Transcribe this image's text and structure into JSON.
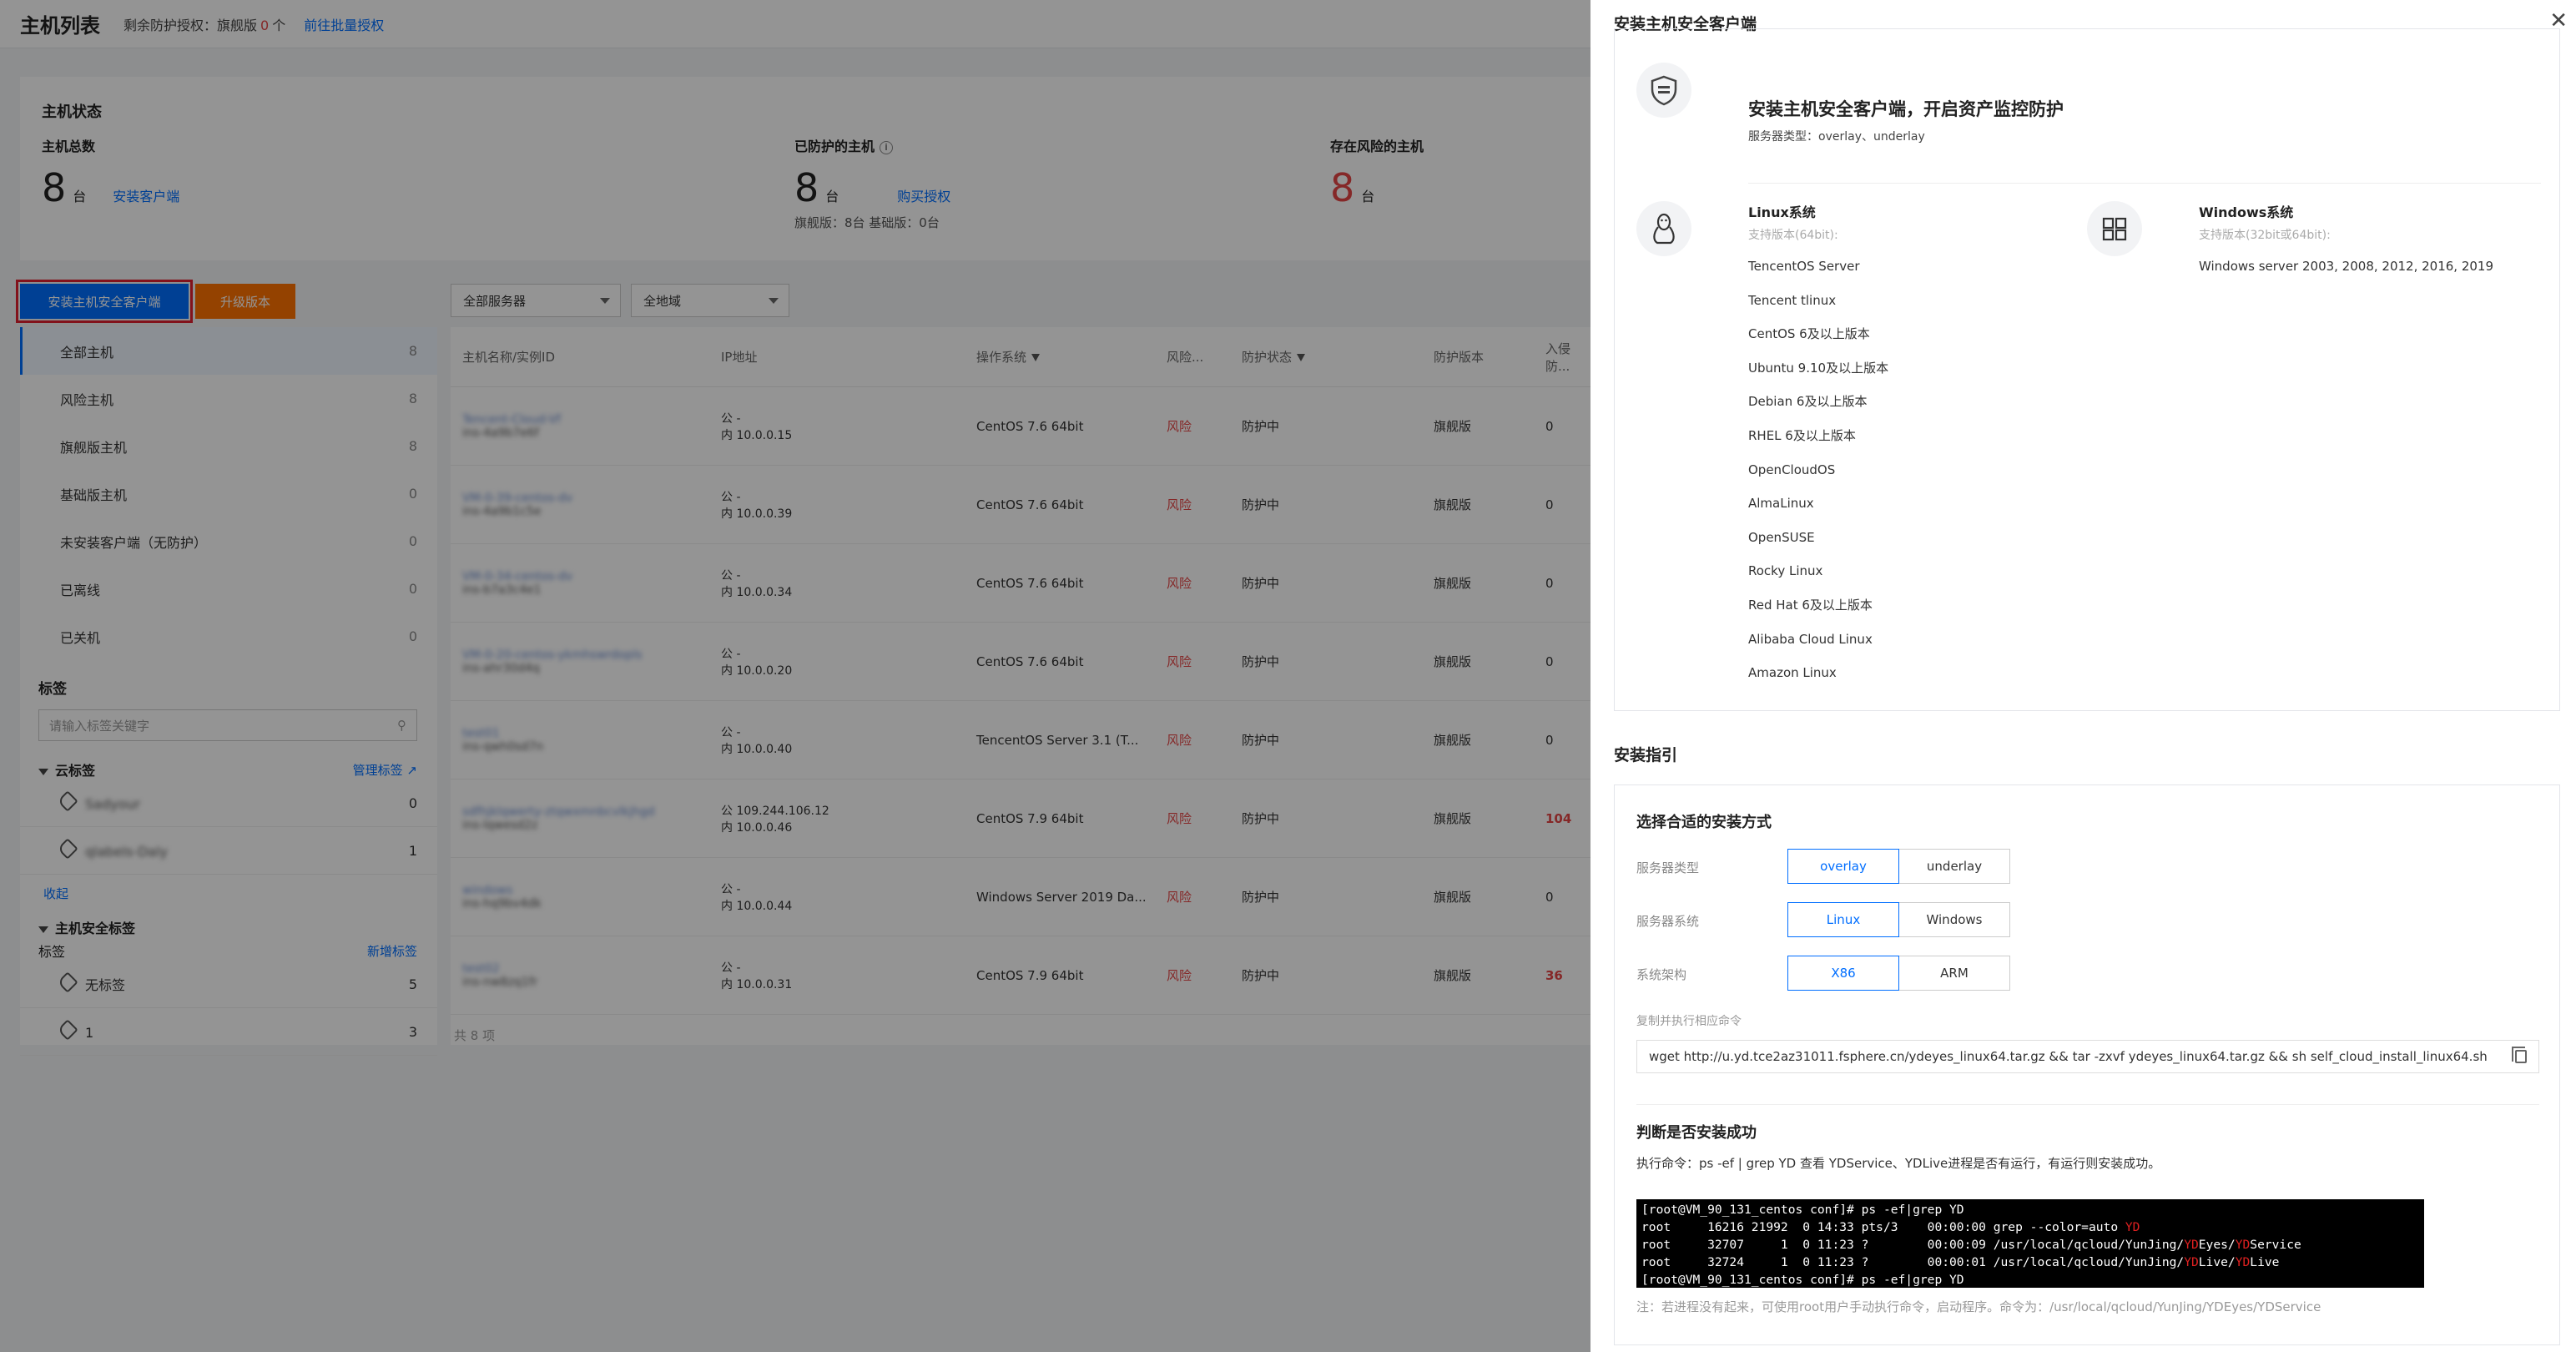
{
  "page": {
    "title": "主机列表",
    "license_label": "剩余防护授权：旗舰版",
    "license_count": "0",
    "license_unit": "个",
    "batch_auth_link": "前往批量授权"
  },
  "stats": {
    "heading": "主机状态",
    "total_label": "主机总数",
    "total_value": "8",
    "total_unit": "台",
    "install_link": "安装客户端",
    "protected_label": "已防护的主机",
    "protected_value": "8",
    "protected_unit": "台",
    "buy_link": "购买授权",
    "protected_sub": "旗舰版：8台     基础版：0台",
    "risk_label": "存在风险的主机",
    "risk_value": "8",
    "risk_unit": "台"
  },
  "toolbar": {
    "install_button": "安装主机安全客户端",
    "upgrade_button": "升级版本",
    "server_select": "全部服务器",
    "region_select": "全地域"
  },
  "sidebar": {
    "items": [
      {
        "label": "全部主机",
        "count": "8"
      },
      {
        "label": "风险主机",
        "count": "8"
      },
      {
        "label": "旗舰版主机",
        "count": "8"
      },
      {
        "label": "基础版主机",
        "count": "0"
      },
      {
        "label": "未安装客户端（无防护）",
        "count": "0"
      },
      {
        "label": "已离线",
        "count": "0"
      },
      {
        "label": "已关机",
        "count": "0"
      }
    ],
    "tags_heading": "标签",
    "tag_search_placeholder": "请输入标签关键字",
    "cloud_tags_label": "云标签",
    "manage_tags": "管理标签",
    "cloud_tags": [
      {
        "label": "Sadyour",
        "count": "0"
      },
      {
        "label": "qlabels-Daly",
        "count": "1"
      }
    ],
    "collapse": "收起",
    "host_tags_label": "主机安全标签",
    "host_tags_sub": "标签",
    "new_tag": "新增标签",
    "host_tags": [
      {
        "label": "无标签",
        "count": "5"
      },
      {
        "label": "1",
        "count": "3"
      }
    ]
  },
  "table": {
    "headers": [
      "主机名称/实例ID",
      "IP地址",
      "操作系统",
      "风险...",
      "防护状态",
      "防护版本",
      "入侵防..."
    ],
    "rows": [
      {
        "name": "Tencent-Cloud-Vf",
        "id": "ins-4a9b7e6f",
        "ip1": "公 -",
        "ip2": "内 10.0.0.15",
        "os": "CentOS 7.6 64bit",
        "risk": "风险",
        "status": "防护中",
        "version": "旗舰版",
        "intrusion": "0",
        "hot": false
      },
      {
        "name": "VM-0-39-centos-dv",
        "id": "ins-4a9b1c5e",
        "ip1": "公 -",
        "ip2": "内 10.0.0.39",
        "os": "CentOS 7.6 64bit",
        "risk": "风险",
        "status": "防护中",
        "version": "旗舰版",
        "intrusion": "0",
        "hot": false
      },
      {
        "name": "VM-0-34-centos-dv",
        "id": "ins-b7a3c4e1",
        "ip1": "公 -",
        "ip2": "内 10.0.0.34",
        "os": "CentOS 7.6 64bit",
        "risk": "风险",
        "status": "防护中",
        "version": "旗舰版",
        "intrusion": "0",
        "hot": false
      },
      {
        "name": "VM-0-20-centos-ykmhswrdopls",
        "id": "ins-ahr30d4q",
        "ip1": "公 -",
        "ip2": "内 10.0.0.20",
        "os": "CentOS 7.6 64bit",
        "risk": "风险",
        "status": "防护中",
        "version": "旗舰版",
        "intrusion": "0",
        "hot": false
      },
      {
        "name": "test01",
        "id": "ins-qwh0sd7n",
        "ip1": "公 -",
        "ip2": "内 10.0.0.40",
        "os": "TencentOS Server 3.1 (T...",
        "risk": "风险",
        "status": "防护中",
        "version": "旗舰版",
        "intrusion": "0",
        "hot": false
      },
      {
        "name": "sdfhjklqwerty-ztqwxmnbcvlkjhgd",
        "id": "ins-lqwesd2z",
        "ip1": "公 109.244.106.12",
        "ip2": "内 10.0.0.46",
        "os": "CentOS 7.9 64bit",
        "risk": "风险",
        "status": "防护中",
        "version": "旗舰版",
        "intrusion": "104",
        "hot": true
      },
      {
        "name": "windows",
        "id": "ins-hq9bv4dk",
        "ip1": "公 -",
        "ip2": "内 10.0.0.44",
        "os": "Windows Server 2019 Da...",
        "risk": "风险",
        "status": "防护中",
        "version": "旗舰版",
        "intrusion": "0",
        "hot": false
      },
      {
        "name": "test02",
        "id": "ins-nw8zq1fr",
        "ip1": "公 -",
        "ip2": "内 10.0.0.31",
        "os": "CentOS 7.9 64bit",
        "risk": "风险",
        "status": "防护中",
        "version": "旗舰版",
        "intrusion": "36",
        "hot": true
      }
    ],
    "footer": "共 8 项"
  },
  "drawer": {
    "title": "安装主机安全客户端",
    "intro_title": "安装主机安全客户端，开启资产监控防护",
    "intro_sub": "服务器类型：overlay、underlay",
    "linux": {
      "title": "Linux系统",
      "support": "支持版本(64bit):",
      "versions": [
        "TencentOS Server",
        "Tencent tlinux",
        "CentOS 6及以上版本",
        "Ubuntu 9.10及以上版本",
        "Debian 6及以上版本",
        "RHEL 6及以上版本",
        "OpenCloudOS",
        "AlmaLinux",
        "OpenSUSE",
        "Rocky Linux",
        "Red Hat 6及以上版本",
        "Alibaba Cloud Linux",
        "Amazon Linux"
      ]
    },
    "windows": {
      "title": "Windows系统",
      "support": "支持版本(32bit或64bit):",
      "versions": [
        "Windows server 2003, 2008, 2012, 2016, 2019"
      ]
    },
    "guide_heading": "安装指引",
    "choose_heading": "选择合适的安装方式",
    "server_type_label": "服务器类型",
    "server_types": [
      "overlay",
      "underlay"
    ],
    "server_os_label": "服务器系统",
    "server_os": [
      "Linux",
      "Windows"
    ],
    "arch_label": "系统架构",
    "arch": [
      "X86",
      "ARM"
    ],
    "cmd_label": "复制并执行相应命令",
    "command": "wget http://u.yd.tce2az31011.fsphere.cn/ydeyes_linux64.tar.gz && tar -zxvf ydeyes_linux64.tar.gz && sh self_cloud_install_linux64.sh",
    "judge_heading": "判断是否安装成功",
    "judge_text": "执行命令：ps -ef | grep YD 查看 YDService、YDLive进程是否有运行，有运行则安装成功。",
    "terminal": {
      "l1": "[root@VM_90_131_centos conf]# ps -ef|grep YD",
      "l2a": "root     16216 21992  0 14:33 pts/3    00:00:00 grep --color=auto ",
      "l2b": "YD",
      "l3a": "root     32707     1  0 11:23 ?        00:00:09 /usr/local/qcloud/YunJing/",
      "l3b": "YD",
      "l3c": "Eyes/",
      "l3d": "YD",
      "l3e": "Service",
      "l4a": "root     32724     1  0 11:23 ?        00:00:01 /usr/local/qcloud/YunJing/",
      "l4b": "YD",
      "l4c": "Live/",
      "l4d": "YD",
      "l4e": "Live",
      "l5": "[root@VM_90_131_centos conf]# ps -ef|grep YD"
    },
    "note": "注：若进程没有起来，可使用root用户手动执行命令，启动程序。命令为：/usr/local/qcloud/YunJing/YDEyes/YDService"
  }
}
